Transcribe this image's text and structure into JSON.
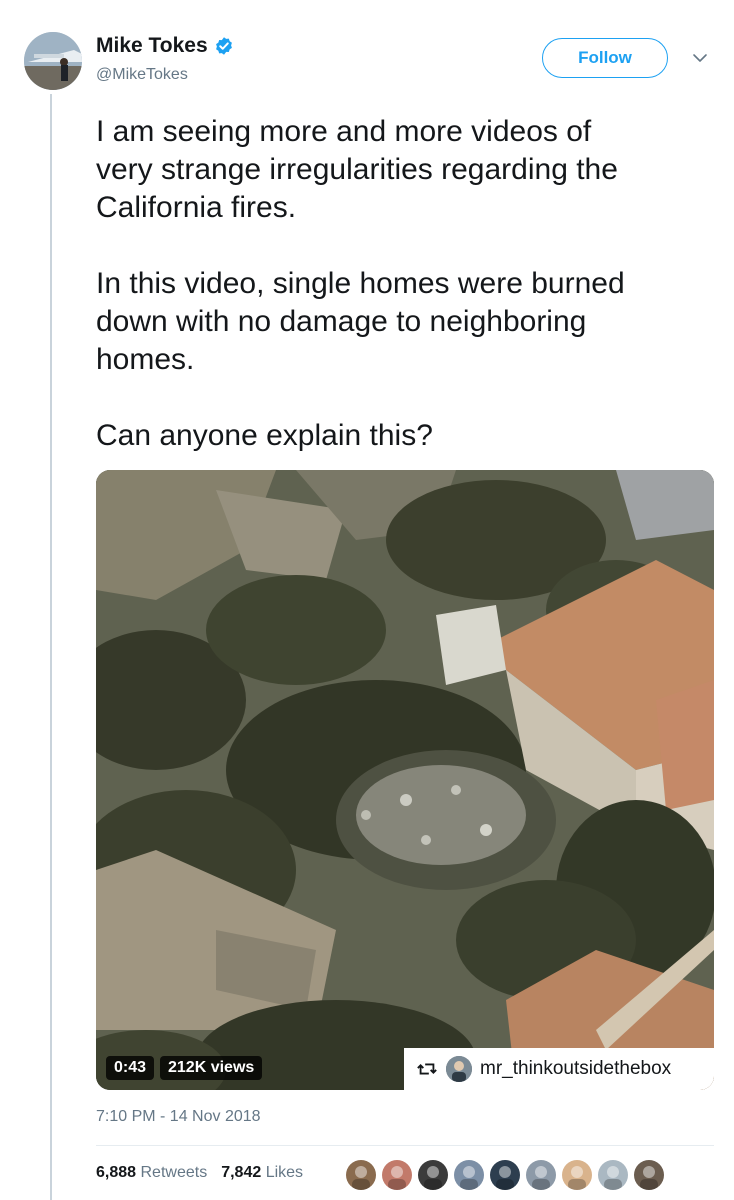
{
  "author": {
    "name": "Mike Tokes",
    "handle": "@MikeTokes",
    "verified_icon": "verified-badge-icon"
  },
  "header": {
    "follow_label": "Follow",
    "more_icon": "chevron-down-icon"
  },
  "tweet": {
    "text": "I am seeing more and more videos of\nvery strange irregularities regarding the\nCalifornia fires.\n\nIn this video, single homes were burned\ndown with no damage to neighboring\nhomes.\n\nCan anyone explain this?"
  },
  "media": {
    "duration": "0:43",
    "views": "212K views",
    "attribution_icon": "retweet-icon",
    "attribution_user": "mr_thinkoutsidethebox"
  },
  "timestamp": "7:10 PM - 14 Nov 2018",
  "stats": {
    "retweets_count": "6,888",
    "retweets_label": "Retweets",
    "likes_count": "7,842",
    "likes_label": "Likes"
  },
  "likers": [
    {
      "color": "#8a6b4e"
    },
    {
      "color": "#c27a6a"
    },
    {
      "color": "#3b3b3b"
    },
    {
      "color": "#7c8fa6"
    },
    {
      "color": "#2d3e4f"
    },
    {
      "color": "#8d9aa8"
    },
    {
      "color": "#d9b38c"
    },
    {
      "color": "#aab8c2"
    },
    {
      "color": "#6b5d4f"
    }
  ],
  "colors": {
    "accent": "#1da1f2",
    "text": "#14171a",
    "secondary": "#657786"
  }
}
